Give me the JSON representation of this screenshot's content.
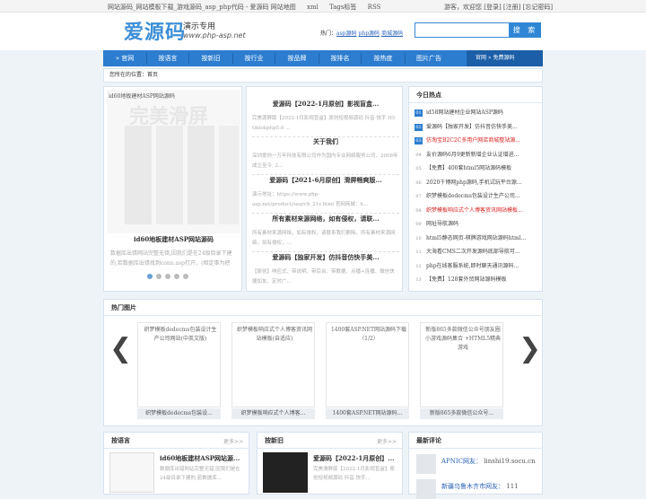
{
  "topbar": {
    "links": [
      "网站源码_网站模板下载_游戏源码_asp_php代码 - 爱源码 网站地图",
      "xml",
      "Tags标签",
      "RSS"
    ],
    "right": "游客，欢迎您 [登录] [注册] [忘记密码]"
  },
  "logo": {
    "main": "爱源码",
    "sub": "演示专用",
    "url": "www.php-asp.net"
  },
  "hot": {
    "label": "热门：",
    "links": [
      "asp源码",
      "php源码",
      "商城源码"
    ]
  },
  "search": {
    "placeholder": "",
    "button": "搜 索"
  },
  "nav": {
    "items": [
      "官网",
      "按语言",
      "按新旧",
      "按行业",
      "按品牌",
      "按排名",
      "按热度",
      "图片广告"
    ],
    "right": "官网 » 免费源码"
  },
  "breadcrumb": {
    "label": "您所在的位置：",
    "current": "首页"
  },
  "slider": {
    "img_alt": "id60地板建材ASP网站源码",
    "watermark": "完美滑屏",
    "title": "id60地板建材ASP网站源码",
    "desc": "数据库出错网站完整无错,因我们是在24级目录下建的,若数据库出错找到conn.asp打开，(相定事为把",
    "dots": 5,
    "active": 0
  },
  "news": [
    {
      "title": "爱源码【2022-1月原创】影视盲盒...",
      "text": "完美源屏版【2022-1月影视盲盒】原创短视频源码 抖音 快手 H5 tiktokphp5.6 ..."
    },
    {
      "title": "关于我们",
      "text": "深圳爱你一万年科技有限公司作为国内专业网络服务公司，2008年成立至今, 2..."
    },
    {
      "title": "爱源码【2021-6月原创】滑屏畅爽版...",
      "text": "演示地址：https://www.php-asp.net/product/search_21v.html 官网商城：h..."
    },
    {
      "title": "所有素材来源网络，如有侵权，请联...",
      "text": "所有素材来源网络，如有侵权，请联系我们删除。所有素材来源网络，如有侵权，..."
    },
    {
      "title": "爱源码【独家开发】仿抖音仿快手美...",
      "text": "【原创】响应式、带说明、带后台、带数据、点播+连播、微信快捷加友、定时广..."
    }
  ],
  "hotlist": {
    "title": "今日热点",
    "items": [
      {
        "n": "01",
        "text": "id58网站建材企业网站ASP源码",
        "style": "top"
      },
      {
        "n": "02",
        "text": "爱源码【独家开发】仿抖音仿快手美...",
        "style": "top"
      },
      {
        "n": "03",
        "text": "仿淘宝B2C2C多用户网店商城整站源...",
        "style": "top-red"
      },
      {
        "n": "04",
        "text": "友价源码6月9更新新增企业认证增进...",
        "style": "plain"
      },
      {
        "n": "05",
        "text": "【免费】400套html5网站源码模板",
        "style": "plain"
      },
      {
        "n": "06",
        "text": "2020千博网php源码,手机试玩平台源...",
        "style": "plain"
      },
      {
        "n": "07",
        "text": "织梦模板dedecms包装设计生产公司...",
        "style": "plain"
      },
      {
        "n": "08",
        "text": "织梦模板响应式个人博客资讯网站模板...",
        "style": "plain-red"
      },
      {
        "n": "09",
        "text": "网址导航源码",
        "style": "plain"
      },
      {
        "n": "10",
        "text": "html5静态网页-棋牌游戏网站源码html...",
        "style": "plain"
      },
      {
        "n": "11",
        "text": "大海看CMS二次开发源码底部导航可...",
        "style": "plain"
      },
      {
        "n": "12",
        "text": "php在线客服系统,即时聊天通讯源码...",
        "style": "plain"
      },
      {
        "n": "13",
        "text": "【免费】128套外贸网站源码模板",
        "style": "plain"
      }
    ]
  },
  "gallery": {
    "title": "热门图片",
    "items": [
      {
        "alt": "织梦模板dedecms包装设计生产公司网站(中英文版)",
        "caption": "织梦模板dedecms包装设..."
      },
      {
        "alt": "织梦模板响应式个人博客资讯网站模板(自适应)",
        "caption": "织梦模板响应式个人博客..."
      },
      {
        "alt": "1400套ASP.NET网站源码下载（1/2）",
        "caption": "1400套ASP.NET网站源码..."
      },
      {
        "alt": "新版865多款微信公众号朋友圈小游戏源码集合 +HTML5精典游戏",
        "caption": "新版865多款微信公众号..."
      }
    ]
  },
  "bottom": {
    "more": "更多>>",
    "col1": {
      "title": "按语言",
      "item_title": "id60地板建材ASP网站源...",
      "item_desc": "数据库出错网站完整无错,因我们是在24级目录下建的,若数据库..."
    },
    "col2": {
      "title": "按新旧",
      "item_title": "爱源码【2022-1月原创】...",
      "item_desc": "完美滑屏版【2022-1月影视盲盒】原创短视频源码 抖音 快手..."
    },
    "col3": {
      "title": "最新评论",
      "c1_user": "APNIC网友：",
      "c1_text": "linshi19.socu.cn",
      "c2_user": "新疆乌鲁木齐市网友：",
      "c2_text": "111"
    }
  }
}
